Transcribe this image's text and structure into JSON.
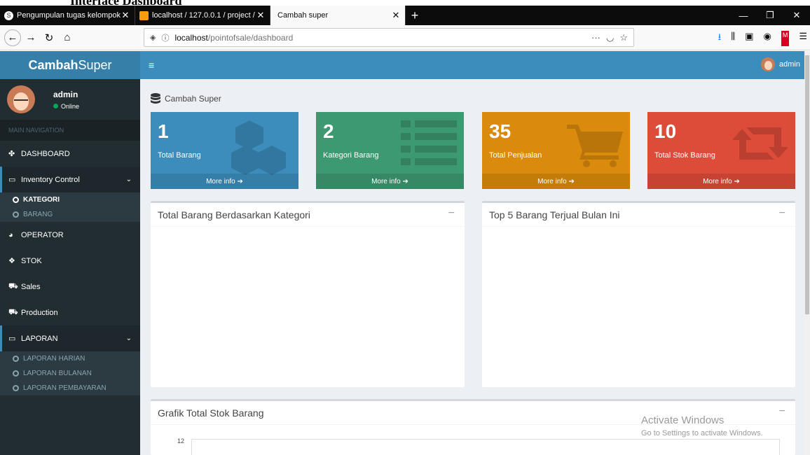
{
  "doc_heading": "Interface Dashboard",
  "browser": {
    "tabs": [
      {
        "title": "Pengumpulan tugas kelompok",
        "close": "✕",
        "favicon": "S"
      },
      {
        "title": "localhost / 127.0.0.1 / project /",
        "close": "✕",
        "favicon": "pma"
      },
      {
        "title": "Cambah super",
        "close": "✕",
        "favicon": ""
      }
    ],
    "newtab": "+",
    "url_host": "localhost",
    "url_path": "/pointofsale/dashboard"
  },
  "app": {
    "logo_bold": "Cambah",
    "logo_rest": "Super",
    "user": {
      "name": "admin",
      "status": "Online"
    },
    "nav_header": "MAIN NAVIGATION",
    "menu": {
      "dashboard": "DASHBOARD",
      "inventory": "Inventory Control",
      "kategori": "KATEGORI",
      "barang": "BARANG",
      "operator": "OPERATOR",
      "stok": "STOK",
      "sales": "Sales",
      "production": "Production",
      "laporan": "LAPORAN",
      "laporan_harian": "LAPORAN HARIAN",
      "laporan_bulanan": "LAPORAN BULANAN",
      "laporan_pembayaran": "LAPORAN PEMBAYARAN"
    },
    "top_user": "admin",
    "breadcrumb": "Cambah Super",
    "boxes": [
      {
        "value": "1",
        "label": "Total Barang",
        "more": "More info",
        "color": "#3c8dbc"
      },
      {
        "value": "2",
        "label": "Kategori Barang",
        "more": "More info",
        "color": "#3d9970"
      },
      {
        "value": "35",
        "label": "Total Penjualan",
        "more": "More info",
        "color": "#db8b0b"
      },
      {
        "value": "10",
        "label": "Total Stok Barang",
        "more": "More info",
        "color": "#dd4b39"
      }
    ],
    "panels": {
      "kategori": "Total Barang Berdasarkan Kategori",
      "top5": "Top 5 Barang Terjual Bulan Ini",
      "grafik": "Grafik Total Stok Barang",
      "grafik_tick": "12"
    }
  },
  "watermark": {
    "line1": "Activate Windows",
    "line2": "Go to Settings to activate Windows."
  }
}
